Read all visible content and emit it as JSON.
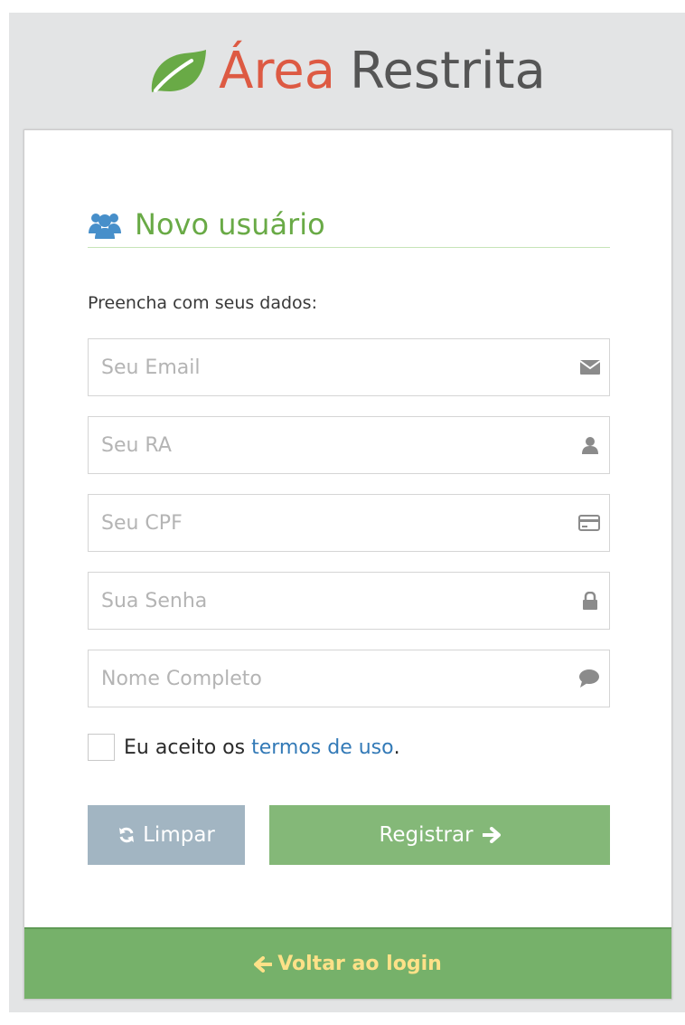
{
  "brand": {
    "word1": "Área",
    "word2": "Restrita",
    "accent_color": "#dd5a43",
    "icon": "leaf-icon"
  },
  "signup": {
    "title": "Novo usuário",
    "title_icon": "users-icon",
    "prompt": "Preencha com seus dados:",
    "fields": {
      "email": {
        "placeholder": "Seu Email",
        "icon": "envelope-icon"
      },
      "ra": {
        "placeholder": "Seu RA",
        "icon": "user-icon"
      },
      "cpf": {
        "placeholder": "Seu CPF",
        "icon": "credit-card-icon"
      },
      "password": {
        "placeholder": "Sua Senha",
        "icon": "lock-icon"
      },
      "name": {
        "placeholder": "Nome Completo",
        "icon": "comment-icon"
      }
    },
    "terms": {
      "prefix": "Eu aceito os ",
      "link": "termos de uso",
      "suffix": "."
    },
    "buttons": {
      "reset": "Limpar",
      "register": "Registrar"
    }
  },
  "toolbar": {
    "back_link": "Voltar ao login"
  },
  "colors": {
    "green": "#69aa46",
    "button_grey": "#a2b5c2",
    "button_green": "#84b878",
    "toolbar_green": "#76b16a",
    "link_yellow": "#fee188"
  }
}
